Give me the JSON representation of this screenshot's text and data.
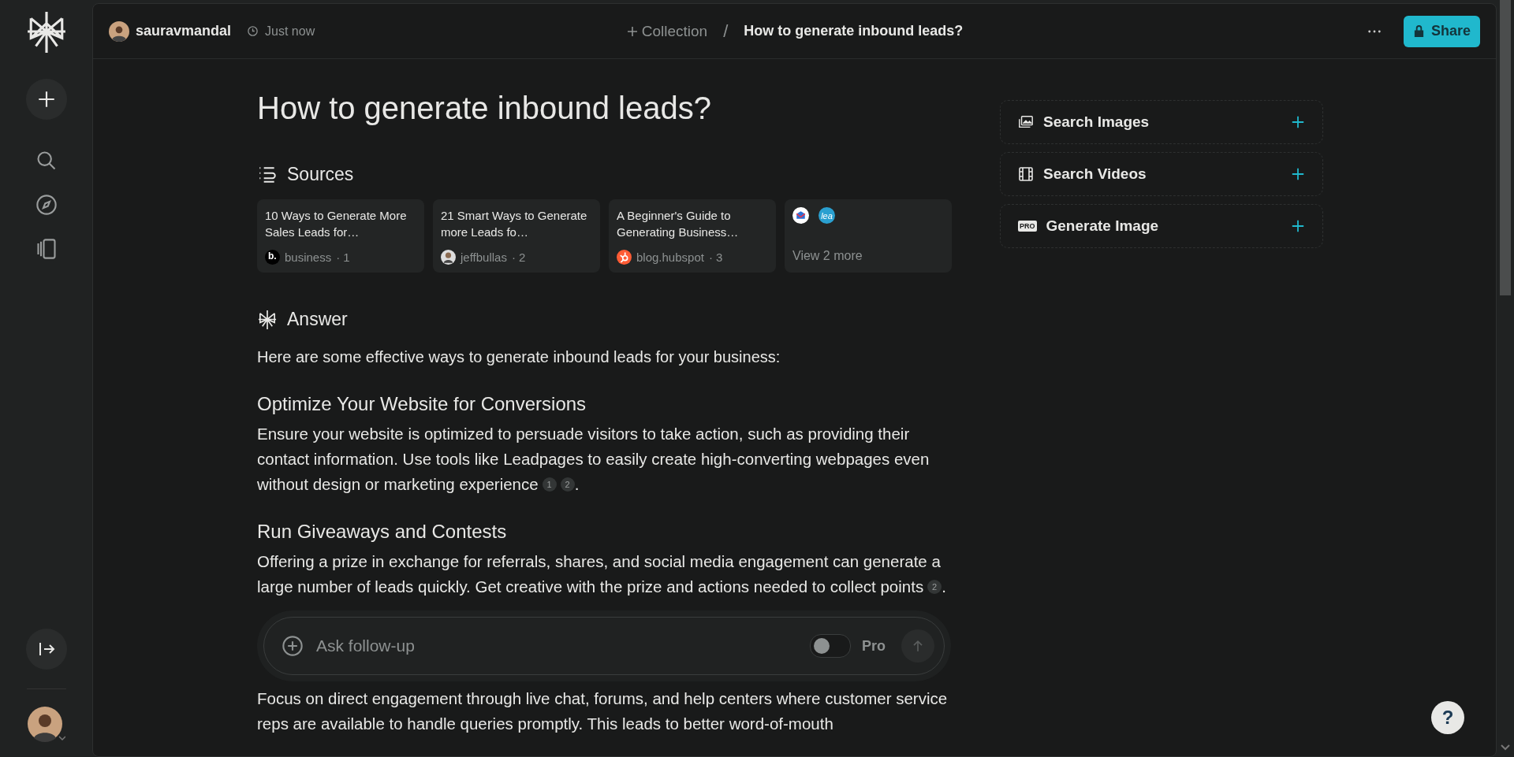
{
  "header": {
    "user": "sauravmandal",
    "time": "Just now",
    "collection": "Collection",
    "separator": "/",
    "title": "How to generate inbound leads?",
    "share": "Share"
  },
  "title": "How to generate inbound leads?",
  "sources": {
    "heading": "Sources",
    "items": [
      {
        "title": "10 Ways to Generate More Sales Leads for…",
        "site": "business",
        "index": "· 1",
        "kind": "letter",
        "badge": "b."
      },
      {
        "title": "21 Smart Ways to Generate more Leads fo…",
        "site": "jeffbullas",
        "index": "· 2",
        "kind": "person"
      },
      {
        "title": "A Beginner's Guide to Generating Business…",
        "site": "blog.hubspot",
        "index": "· 3",
        "kind": "hub"
      }
    ],
    "more": {
      "label": "View 2 more",
      "badge": "lea"
    }
  },
  "answer": {
    "heading": "Answer",
    "intro": "Here are some effective ways to generate inbound leads for your business:",
    "sections": [
      {
        "heading": "Optimize Your Website for Conversions",
        "text": "Ensure your website is optimized to persuade visitors to take action, such as providing their contact information. Use tools like Leadpages to easily create high-converting webpages even without design or marketing experience",
        "citations": [
          "1",
          "2"
        ],
        "after": "."
      },
      {
        "heading": "Run Giveaways and Contests",
        "text": "Offering a prize in exchange for referrals, shares, and social media engagement can generate a large number of leads quickly. Get creative with the prize and actions needed to collect points",
        "citations": [
          "2"
        ],
        "after": "."
      }
    ],
    "tail": "Focus on direct engagement through live chat, forums, and help centers where customer service reps are available to handle queries promptly. This leads to better word-of-mouth"
  },
  "followup": {
    "placeholder": "Ask follow-up",
    "pro": {
      "label": "Pro",
      "on": false
    }
  },
  "actions": [
    {
      "label": "Search Images",
      "kind": "images"
    },
    {
      "label": "Search Videos",
      "kind": "videos"
    },
    {
      "label": "Generate Image",
      "kind": "generate",
      "badge": "PRO"
    }
  ],
  "help": "?"
}
